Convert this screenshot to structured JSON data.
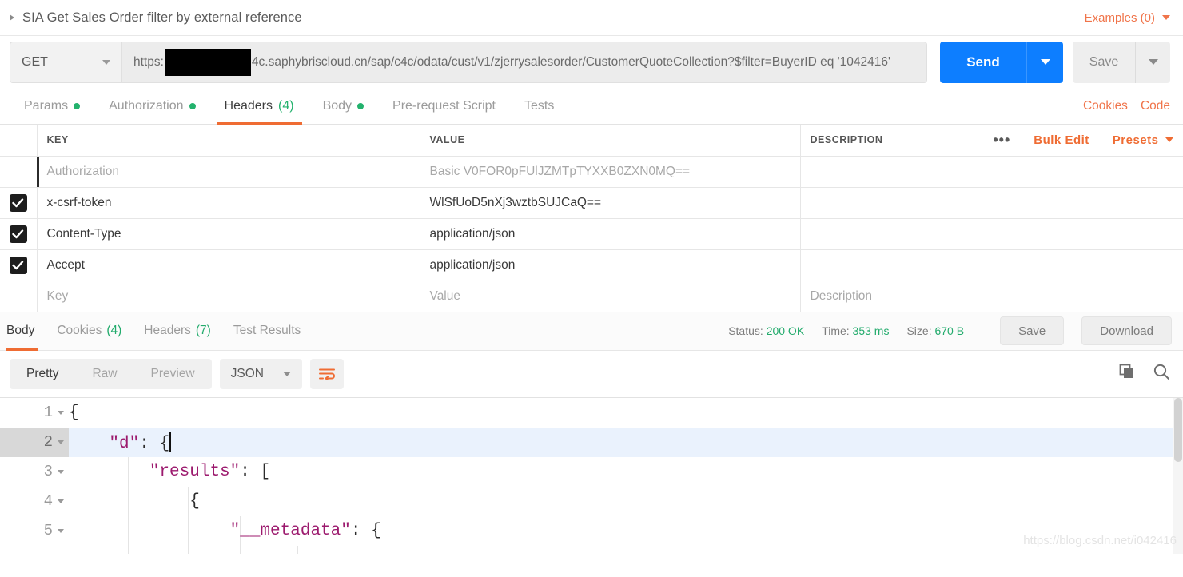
{
  "titlebar": {
    "expand_icon": "triangle-right-icon",
    "request_name": "SIA Get Sales Order filter by external reference",
    "examples_label": "Examples (0)"
  },
  "urlbar": {
    "method": "GET",
    "url_prefix": "https:",
    "url_suffix": "4c.saphybriscloud.cn/sap/c4c/odata/cust/v1/zjerrysalesorder/CustomerQuoteCollection?$filter=BuyerID eq '1042416'",
    "url_redacted": true,
    "send_label": "Send",
    "save_label": "Save",
    "send_color": "#0d7eff"
  },
  "request_tabs": {
    "items": [
      {
        "label": "Params",
        "dot": true,
        "count": "",
        "active": false
      },
      {
        "label": "Authorization",
        "dot": true,
        "count": "",
        "active": false
      },
      {
        "label": "Headers",
        "dot": false,
        "count": "(4)",
        "active": true
      },
      {
        "label": "Body",
        "dot": true,
        "count": "",
        "active": false
      },
      {
        "label": "Pre-request Script",
        "dot": false,
        "count": "",
        "active": false
      },
      {
        "label": "Tests",
        "dot": false,
        "count": "",
        "active": false
      }
    ],
    "cookies_label": "Cookies",
    "code_label": "Code",
    "accent": "#ef6c33",
    "dot_color": "#23b26d"
  },
  "headers_table": {
    "columns": [
      "KEY",
      "VALUE",
      "DESCRIPTION"
    ],
    "tools": {
      "more_label": "•••",
      "bulk_edit_label": "Bulk Edit",
      "presets_label": "Presets"
    },
    "rows": [
      {
        "checked": false,
        "marker": true,
        "key": "Authorization",
        "value": "Basic V0FOR0pFUlJZMTpTYXXB0ZXN0MQ==",
        "description": "",
        "placeholder": false
      },
      {
        "checked": true,
        "marker": false,
        "key": "x-csrf-token",
        "value": "WlSfUoD5nXj3wztbSUJCaQ==",
        "description": "",
        "placeholder": false
      },
      {
        "checked": true,
        "marker": false,
        "key": "Content-Type",
        "value": "application/json",
        "description": "",
        "placeholder": false
      },
      {
        "checked": true,
        "marker": false,
        "key": "Accept",
        "value": "application/json",
        "description": "",
        "placeholder": false
      },
      {
        "checked": false,
        "marker": false,
        "key": "Key",
        "value": "Value",
        "description": "Description",
        "placeholder": true
      }
    ]
  },
  "response": {
    "tabs": [
      {
        "label": "Body",
        "count": "",
        "active": true
      },
      {
        "label": "Cookies",
        "count": "(4)",
        "active": false
      },
      {
        "label": "Headers",
        "count": "(7)",
        "active": false
      },
      {
        "label": "Test Results",
        "count": "",
        "active": false
      }
    ],
    "status_label": "Status:",
    "status_value": "200 OK",
    "time_label": "Time:",
    "time_value": "353 ms",
    "size_label": "Size:",
    "size_value": "670 B",
    "save_label": "Save",
    "download_label": "Download",
    "ok_color": "#22ab6c"
  },
  "format_bar": {
    "modes": [
      {
        "label": "Pretty",
        "active": true
      },
      {
        "label": "Raw",
        "active": false
      },
      {
        "label": "Preview",
        "active": false
      }
    ],
    "language": "JSON",
    "wrap_icon": "word-wrap-icon",
    "copy_icon": "copy-icon",
    "search_icon": "search-icon"
  },
  "editor": {
    "lines": [
      {
        "num": "1",
        "fold": true,
        "indent": 0,
        "text": "{",
        "key": "",
        "highlight": false,
        "caret": false
      },
      {
        "num": "2",
        "fold": true,
        "indent": 1,
        "text": ": {",
        "key": "\"d\"",
        "highlight": true,
        "caret": true
      },
      {
        "num": "3",
        "fold": true,
        "indent": 2,
        "text": ": [",
        "key": "\"results\"",
        "highlight": false,
        "caret": false
      },
      {
        "num": "4",
        "fold": true,
        "indent": 3,
        "text": "{",
        "key": "",
        "highlight": false,
        "caret": false
      },
      {
        "num": "5",
        "fold": true,
        "indent": 4,
        "text": ": {",
        "key": "\"__metadata\"",
        "highlight": false,
        "caret": false
      }
    ],
    "watermark": "https://blog.csdn.net/i042416"
  }
}
